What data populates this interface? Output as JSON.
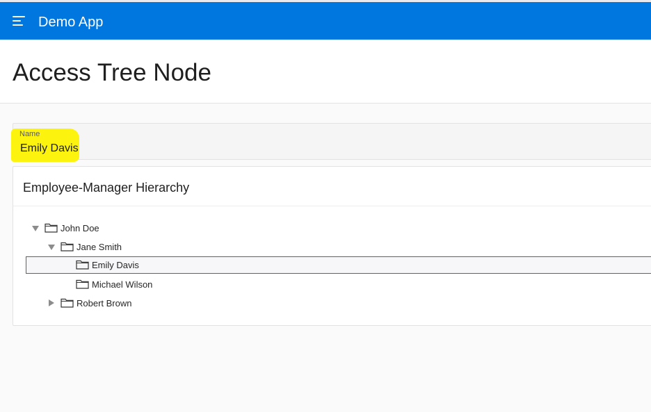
{
  "header": {
    "app_title": "Demo App",
    "menu_icon": "hamburger-menu-icon",
    "background": "#0076df"
  },
  "page": {
    "title": "Access Tree Node"
  },
  "name_item": {
    "label": "Name",
    "value": "Emily Davis",
    "highlight_color": "#fcf40f"
  },
  "tree_region": {
    "title": "Employee-Manager Hierarchy",
    "nodes": [
      {
        "label": "John Doe",
        "level": 1,
        "state": "expanded",
        "icon": "folder-icon"
      },
      {
        "label": "Jane Smith",
        "level": 2,
        "state": "expanded",
        "icon": "folder-icon"
      },
      {
        "label": "Emily Davis",
        "level": 3,
        "state": "leaf",
        "selected": true,
        "icon": "folder-icon"
      },
      {
        "label": "Michael Wilson",
        "level": 3,
        "state": "leaf",
        "icon": "folder-icon"
      },
      {
        "label": "Robert Brown",
        "level": 2,
        "state": "collapsed",
        "icon": "folder-icon"
      }
    ],
    "selection_color": "#1a6fd4"
  }
}
